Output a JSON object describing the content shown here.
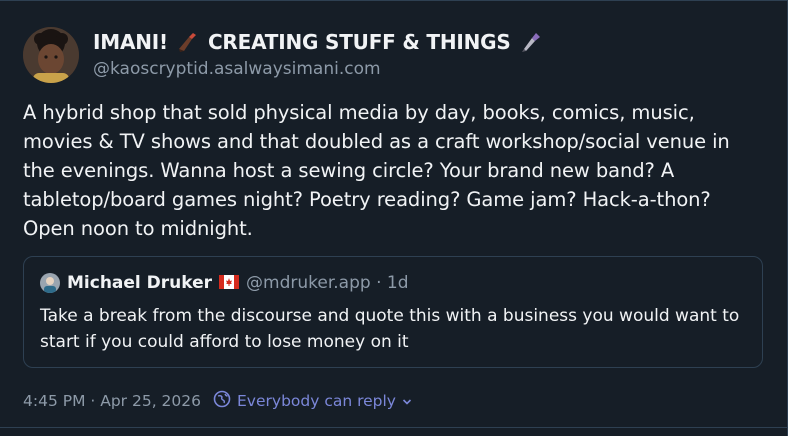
{
  "post": {
    "author": {
      "display_name": "IMANI!",
      "display_name_suffix": "CREATING STUFF & THINGS",
      "emoji_1": "writing-hand-icon",
      "emoji_2": "fountain-pen-icon",
      "handle": "@kaoscryptid.asalwaysimani.com"
    },
    "text": "A hybrid shop that sold physical media by day, books, comics, music, movies & TV shows and that doubled as a craft workshop/social venue in the evenings. Wanna host a sewing circle? Your brand new band? A tabletop/board games night? Poetry reading? Game jam? Hack-a-thon? Open noon to midnight.",
    "quote": {
      "author_name": "Michael Druker",
      "flag": "canada-flag-icon",
      "handle_time": "@mdruker.app · 1d",
      "text": "Take a break from the discourse and quote this with a business you would want to start if you could afford to lose money on it"
    },
    "meta": {
      "timestamp": "4:45 PM · Apr 25, 2026",
      "reply_setting": "Everybody can reply",
      "reply_icon": "globe-icon",
      "reply_chevron": "chevron-down-icon"
    }
  },
  "colors": {
    "background": "#161e27",
    "text": "#f1f3f5",
    "muted": "#8d9aa8",
    "accent": "#7b87d9",
    "border": "#2e4052"
  }
}
